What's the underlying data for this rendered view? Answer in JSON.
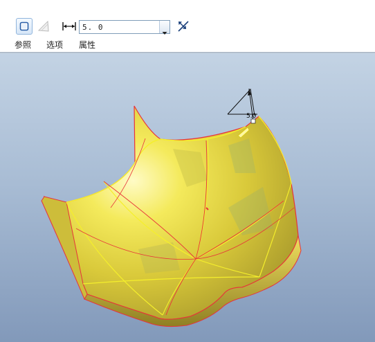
{
  "dashboard": {
    "toolbar": {
      "solid_thicken_icon": "solid-thicken-icon",
      "surface_trim_icon": "surface-trim-icon",
      "thickness_dimension_icon": "thickness-dimension-icon",
      "thickness_value": "5. 0",
      "flip_direction_icon": "flip-direction-icon"
    },
    "tabs": [
      {
        "label": "参照"
      },
      {
        "label": "选项"
      },
      {
        "label": "属性"
      }
    ]
  },
  "viewport": {
    "dimension_label": "5.0"
  },
  "colors": {
    "surface": "#e9de3a",
    "edge_red": "#e8323a",
    "edge_yellow": "#f5ef2c",
    "background_top": "#c3d3e4",
    "background_bottom": "#8299ba"
  }
}
